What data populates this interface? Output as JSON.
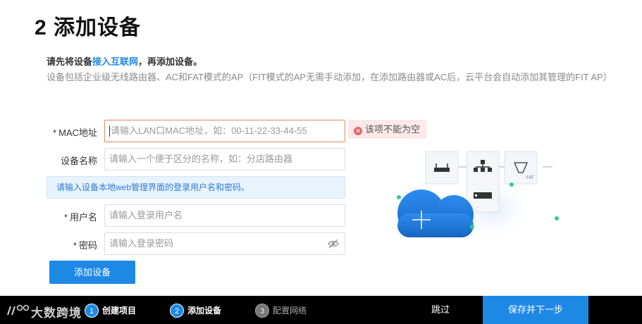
{
  "page": {
    "title": "2 添加设备",
    "intro_prefix": "请先将设备",
    "intro_link": "接入互联网",
    "intro_suffix": "，再添加设备。",
    "intro_desc": "设备包括企业级无线路由器、AC和FAT模式的AP（FIT模式的AP无需手动添加，在添加路由器或AC后，云平台会自动添加其管理的FIT AP）"
  },
  "form": {
    "required_mark": "*",
    "mac": {
      "label": "MAC地址",
      "placeholder": "请输入LAN口MAC地址，如：00-11-22-33-44-55",
      "error": "该项不能为空",
      "error_icon": "close-circle-icon"
    },
    "device_name": {
      "label": "设备名称",
      "placeholder": "请输入一个便于区分的名称，如：分店路由器"
    },
    "info": "请输入设备本地web管理界面的登录用户名和密码。",
    "username": {
      "label": "用户名",
      "placeholder": "请输入登录用户名"
    },
    "password": {
      "label": "密码",
      "placeholder": "请输入登录密码",
      "toggle_icon": "eye-off-icon"
    },
    "submit_label": "添加设备"
  },
  "illustration": {
    "fat_label": "FAT"
  },
  "footer": {
    "brand": "大数跨境",
    "steps": [
      {
        "num": "1",
        "label": "创建项目",
        "state": "done"
      },
      {
        "num": "2",
        "label": "添加设备",
        "state": "active"
      },
      {
        "num": "3",
        "label": "配置网络",
        "state": "pending"
      }
    ],
    "skip_label": "跳过",
    "save_label": "保存并下一步"
  },
  "colors": {
    "primary": "#1e88e5",
    "error": "#e36a6a",
    "error_bg": "#fde9e9",
    "accent_green": "#2ecc8f",
    "footer_bg": "#000000"
  }
}
